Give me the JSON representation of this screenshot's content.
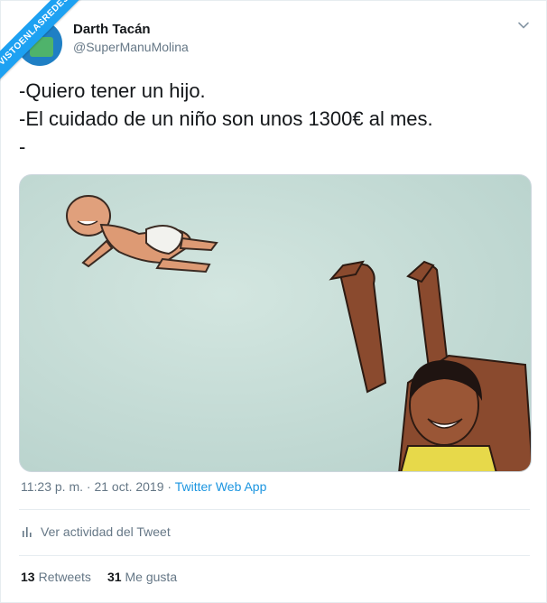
{
  "watermark": "VISTOENLASREDES",
  "author": {
    "name": "Darth Tacán",
    "handle": "@SuperManuMolina"
  },
  "tweet": {
    "line1": "-Quiero tener un hijo.",
    "line2": "-El cuidado de un niño son unos 1300€ al mes.",
    "line3": "-"
  },
  "meta": {
    "timestamp": "11:23 p. m. · 21 oct. 2019 · ",
    "app": "Twitter Web App"
  },
  "activity_label": "Ver actividad del Tweet",
  "stats": {
    "retweets_count": "13",
    "retweets_label": "Retweets",
    "likes_count": "31",
    "likes_label": "Me gusta"
  },
  "colors": {
    "accent": "#1b95e0",
    "muted": "#657786",
    "text": "#14171a",
    "image_bg": "#c5dcd6"
  },
  "icons": [
    "chevron-down-icon",
    "bar-chart-icon"
  ]
}
